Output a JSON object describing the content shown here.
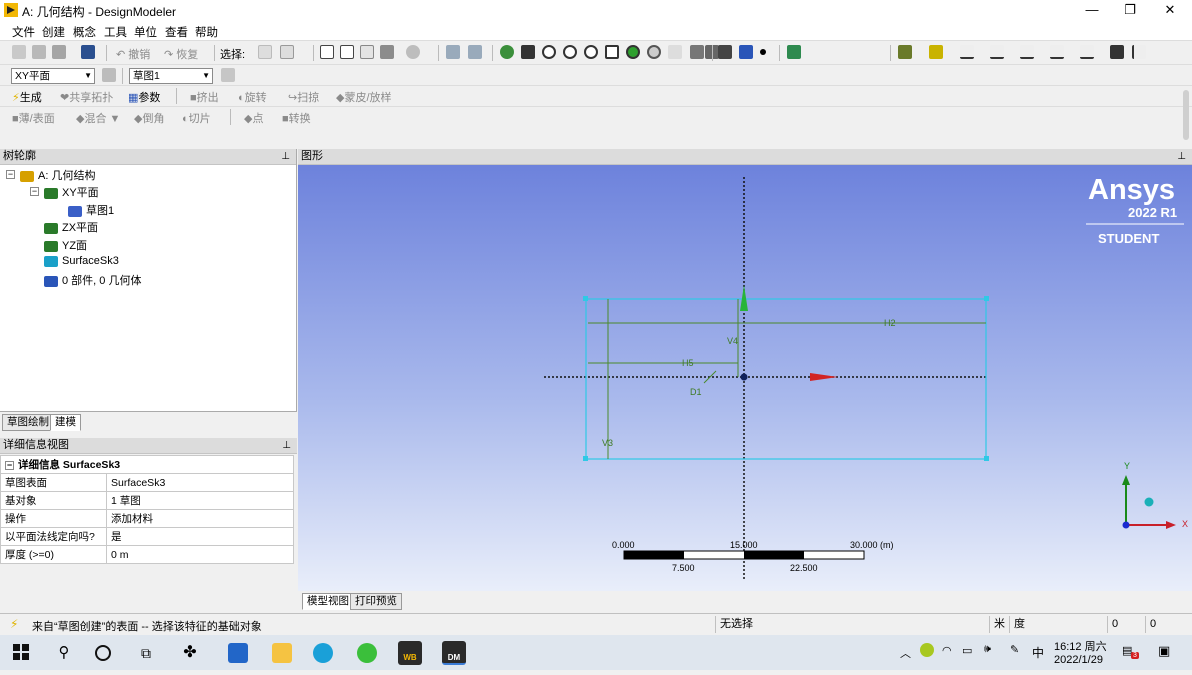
{
  "window": {
    "title": "A: 几何结构 - DesignModeler",
    "minimize": "—",
    "restore": "❐",
    "close": "✕"
  },
  "menu": [
    "文件",
    "创建",
    "概念",
    "工具",
    "单位",
    "查看",
    "帮助"
  ],
  "toolbar1": {
    "undo": "撤销",
    "redo": "恢复",
    "select_label": "选择:"
  },
  "toolbar2": {
    "plane_combo": "XY平面",
    "sketch_combo": "草图1"
  },
  "toolbar3": {
    "generate": "生成",
    "share_topology": "共享拓扑",
    "parameters": "参数",
    "extrude": "挤出",
    "revolve": "旋转",
    "sweep": "扫掠",
    "skin_loft": "蒙皮/放样"
  },
  "toolbar4": {
    "thin_surface": "薄/表面",
    "blend": "混合",
    "chamfer": "倒角",
    "slice": "切片",
    "point": "点",
    "convert": "转换"
  },
  "tree": {
    "header": "树轮廓",
    "pin": "⊥",
    "nodes": [
      {
        "label": "A: 几何结构",
        "icon": "geometry-icon",
        "color": "#d6a000"
      },
      {
        "label": "XY平面",
        "icon": "plane-icon",
        "color": "#2a7a2a"
      },
      {
        "label": "草图1",
        "icon": "sketch-icon",
        "color": "#3a5fc7"
      },
      {
        "label": "ZX平面",
        "icon": "plane-icon",
        "color": "#2a7a2a"
      },
      {
        "label": "YZ面",
        "icon": "plane-icon",
        "color": "#2a7a2a"
      },
      {
        "label": "SurfaceSk3",
        "icon": "surface-icon",
        "color": "#1aa0c8"
      },
      {
        "label": "0 部件, 0 几何体",
        "icon": "parts-icon",
        "color": "#2a55b8"
      }
    ]
  },
  "bottom_tabs": {
    "sketching": "草图绘制",
    "modeling": "建模"
  },
  "details": {
    "header": "详细信息视图",
    "group": "详细信息 SurfaceSk3",
    "rows": [
      {
        "key": "草图表面",
        "value": "SurfaceSk3"
      },
      {
        "key": "基对象",
        "value": "1 草图"
      },
      {
        "key": "操作",
        "value": "添加材料"
      },
      {
        "key": "以平面法线定向吗?",
        "value": "是"
      },
      {
        "key": "厚度 (>=0)",
        "value": "0 m"
      }
    ]
  },
  "graphics": {
    "header": "图形",
    "brand": "Ansys",
    "version": "2022 R1",
    "edition": "STUDENT",
    "dims": {
      "h2": "H2",
      "h5": "H5",
      "v4": "V4",
      "v3": "V3",
      "d1": "D1"
    },
    "scale": {
      "t0": "0.000",
      "t1": "15.000",
      "t2": "30.000 (m)",
      "b1": "7.500",
      "b2": "22.500"
    },
    "triad": {
      "y": "Y",
      "x": "X"
    },
    "view_tabs": {
      "model": "模型视图",
      "print": "打印预览"
    }
  },
  "status": {
    "message": "来自“草图创建”的表面 -- 选择该特征的基础对象",
    "selection": "无选择",
    "unit_m": "米",
    "unit_deg": "度",
    "v1": "0",
    "v2": "0"
  },
  "taskbar": {
    "time": "16:12 周六",
    "date": "2022/1/29",
    "ime": "中",
    "notif_badge": "3",
    "wb": "WB",
    "dm": "DM"
  }
}
